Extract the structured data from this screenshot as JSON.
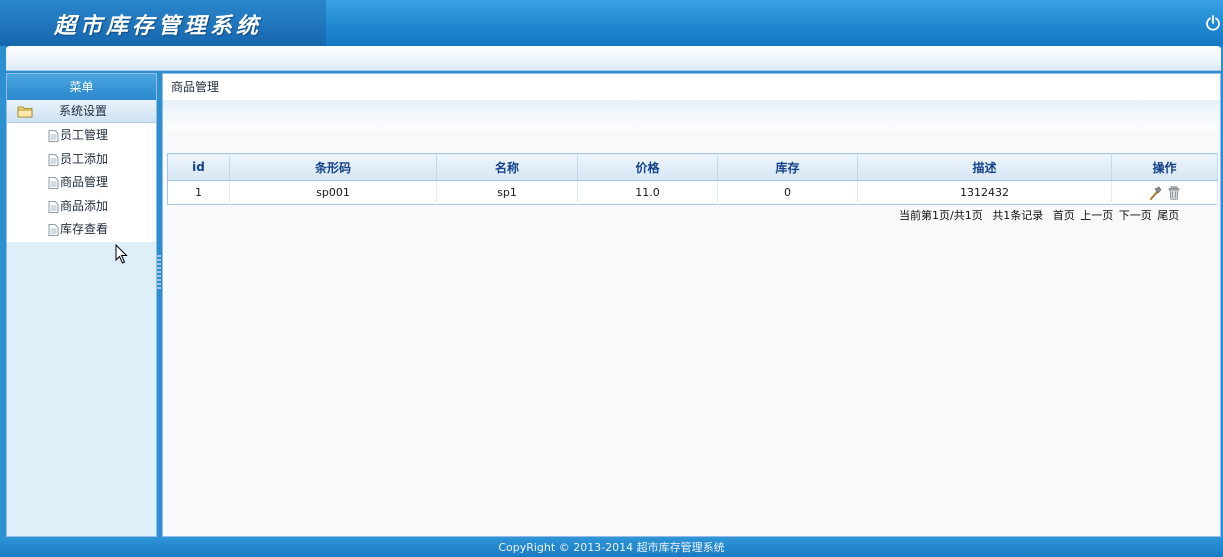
{
  "header": {
    "app_title": "超市库存管理系统"
  },
  "sidebar": {
    "title": "菜单",
    "group": {
      "label": "系统设置",
      "items": [
        {
          "label": "员工管理"
        },
        {
          "label": "员工添加"
        },
        {
          "label": "商品管理"
        },
        {
          "label": "商品添加"
        },
        {
          "label": "库存查看"
        }
      ]
    }
  },
  "main": {
    "tab_title": "商品管理",
    "table": {
      "columns": [
        "id",
        "条形码",
        "名称",
        "价格",
        "库存",
        "描述",
        "操作"
      ],
      "rows": [
        {
          "id": "1",
          "barcode": "sp001",
          "name": "sp1",
          "price": "11.0",
          "stock": "0",
          "description": "1312432"
        }
      ]
    },
    "pager": {
      "page_info": "当前第1页/共1页",
      "record_info": "共1条记录",
      "first": "首页",
      "prev": "上一页",
      "next": "下一页",
      "last": "尾页"
    }
  },
  "footer": {
    "copyright": "CopyRight © 2013-2014 超市库存管理系统"
  },
  "colors": {
    "header_blue": "#1e86cf",
    "header_text": "#15428b",
    "sidebar_bg": "#dfeffa"
  },
  "icons": [
    "power-icon",
    "folder-icon",
    "document-icon",
    "edit-hammer-icon",
    "trash-icon"
  ]
}
